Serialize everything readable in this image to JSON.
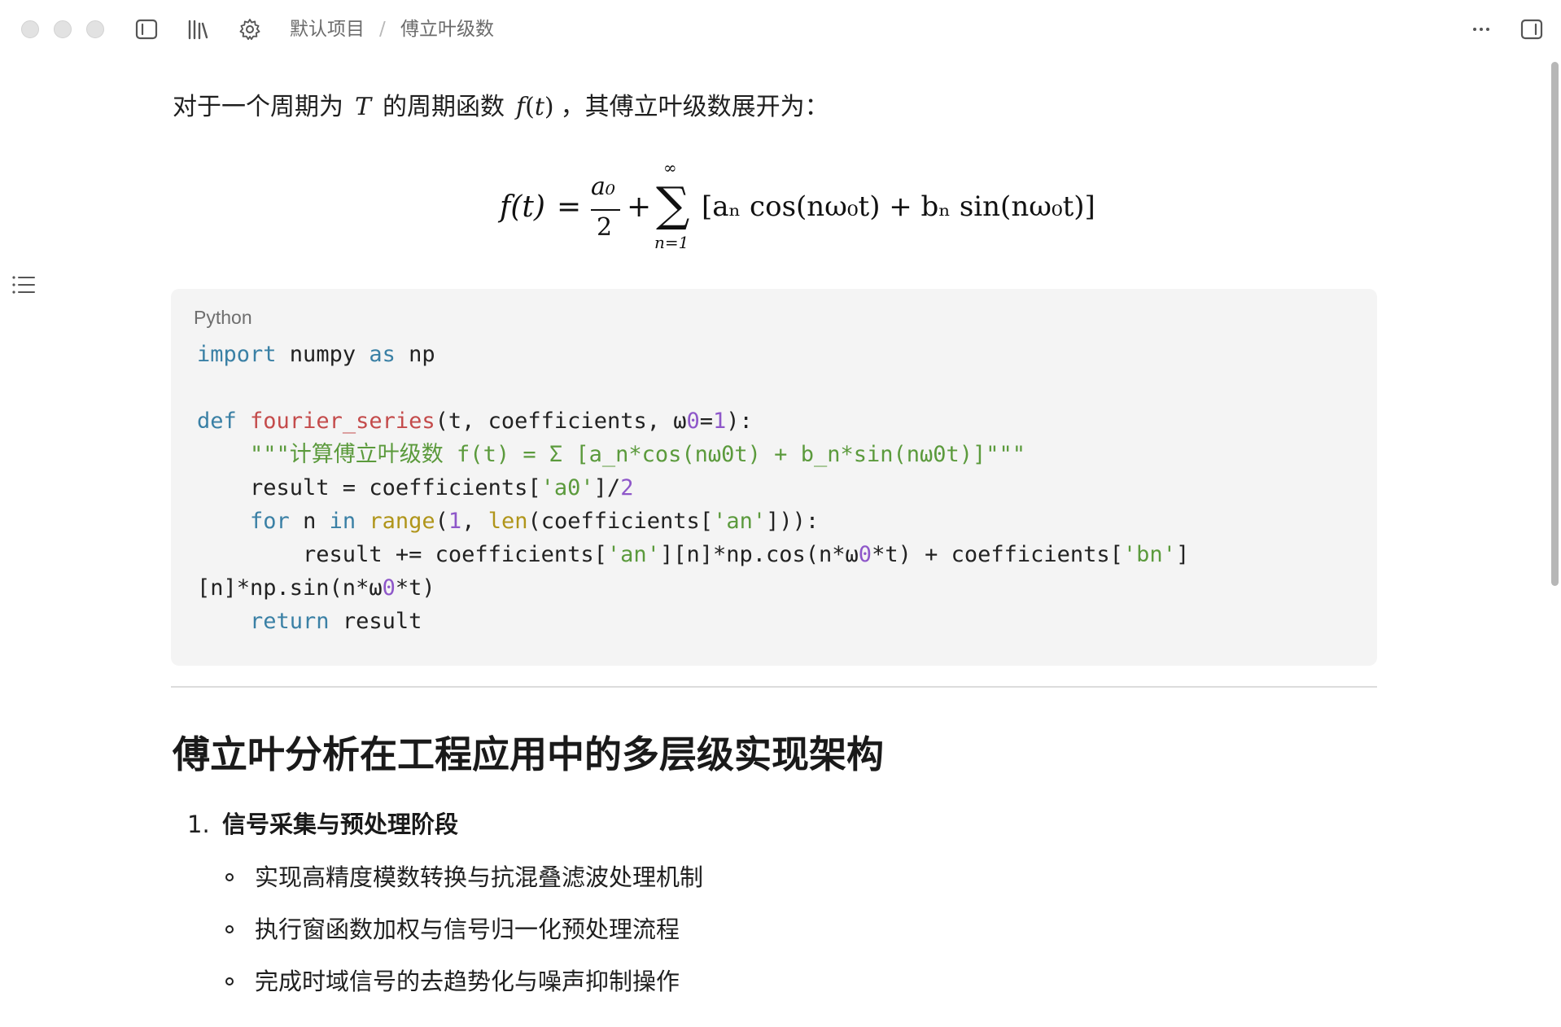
{
  "titlebar": {
    "breadcrumb_project": "默认项目",
    "breadcrumb_separator": "/",
    "breadcrumb_doc": "傅立叶级数"
  },
  "intro": {
    "text_1": "对于一个周期为",
    "math_T": "T",
    "text_2": "的周期函数",
    "math_f": "f",
    "math_paren_open": "(",
    "math_t": "t",
    "math_paren_close": ")",
    "text_3": "，其傅立叶级数展开为："
  },
  "formula": {
    "lhs": "f(t)",
    "equals": "=",
    "numerator": "a₀",
    "denominator": "2",
    "plus": "+",
    "sum_symbol": "∑",
    "sum_upper": "∞",
    "sum_lower": "n=1",
    "body": "[aₙ cos(nω₀t) + bₙ sin(nω₀t)]"
  },
  "code": {
    "language": "Python",
    "lines": [
      "import numpy as np",
      "",
      "def fourier_series(t, coefficients, ω0=1):",
      "    \"\"\"计算傅立叶级数 f(t) = Σ [a_n*cos(nω0t) + b_n*sin(nω0t)]\"\"\"",
      "    result = coefficients['a0']/2",
      "    for n in range(1, len(coefficients['an'])):",
      "        result += coefficients['an'][n]*np.cos(n*ω0*t) + coefficients['bn']",
      "[n]*np.sin(n*ω0*t)",
      "    return result"
    ]
  },
  "section": {
    "heading": "傅立叶分析在工程应用中的多层级实现架构",
    "list_number": "1.",
    "list_title": "信号采集与预处理阶段",
    "bullets": [
      "实现高精度模数转换与抗混叠滤波处理机制",
      "执行窗函数加权与信号归一化预处理流程",
      "完成时域信号的去趋势化与噪声抑制操作"
    ]
  },
  "colors": {
    "keyword": "#3a80a5",
    "function_name": "#c44b4b",
    "builtin": "#b0951a",
    "number": "#8e57c9",
    "string": "#5b9a3c",
    "code_background": "#f4f4f4"
  }
}
